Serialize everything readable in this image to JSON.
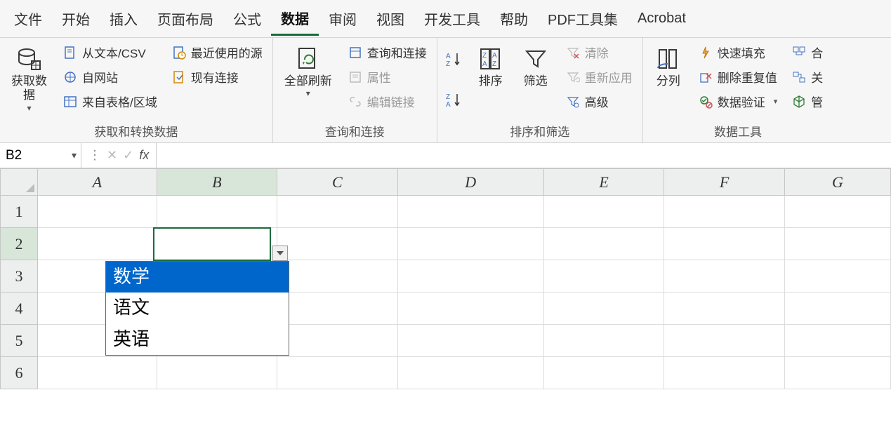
{
  "menu": {
    "items": [
      "文件",
      "开始",
      "插入",
      "页面布局",
      "公式",
      "数据",
      "审阅",
      "视图",
      "开发工具",
      "帮助",
      "PDF工具集",
      "Acrobat"
    ],
    "active_index": 5
  },
  "ribbon": {
    "groups": [
      {
        "label": "获取和转换数据",
        "big": {
          "text": "获取数\n据"
        },
        "small": [
          "从文本/CSV",
          "自网站",
          "来自表格/区域",
          "最近使用的源",
          "现有连接"
        ]
      },
      {
        "label": "查询和连接",
        "big": {
          "text": "全部刷新"
        },
        "small": [
          "查询和连接",
          "属性",
          "编辑链接"
        ],
        "disabled": [
          1,
          2
        ]
      },
      {
        "label": "排序和筛选",
        "big1": {
          "text": "排序"
        },
        "big2": {
          "text": "筛选"
        },
        "small": [
          "清除",
          "重新应用",
          "高级"
        ],
        "disabled": [
          0,
          1
        ]
      },
      {
        "label": "数据工具",
        "big": {
          "text": "分列"
        },
        "small": [
          "快速填充",
          "删除重复值",
          "数据验证",
          "合",
          "关",
          "管"
        ]
      }
    ]
  },
  "formula_bar": {
    "cell_ref": "B2",
    "fx_label": "fx",
    "value": ""
  },
  "grid": {
    "columns": [
      "A",
      "B",
      "C",
      "D",
      "E",
      "F",
      "G"
    ],
    "rows": [
      "1",
      "2",
      "3",
      "4",
      "5",
      "6"
    ],
    "selected_col_index": 1,
    "selected_row_index": 1
  },
  "dropdown": {
    "options": [
      "数学",
      "语文",
      "英语"
    ],
    "highlight_index": 0
  }
}
